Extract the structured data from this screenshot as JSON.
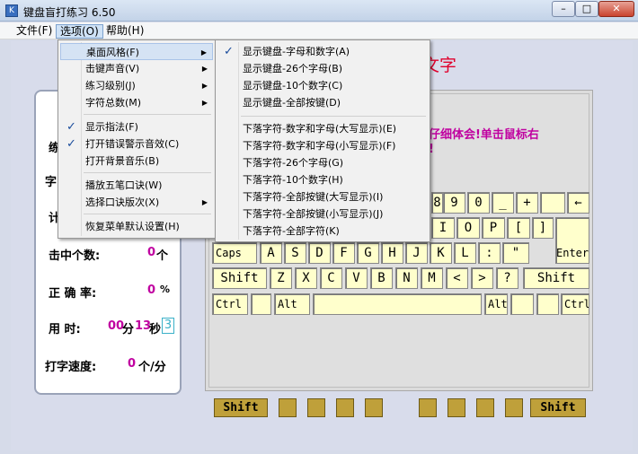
{
  "window": {
    "title": "键盘盲打练习 6.50",
    "icon": "K",
    "min": "–",
    "max": "□",
    "close": "✕"
  },
  "menubar": {
    "file": "文件(F)",
    "options": "选项(O)",
    "help": "帮助(H)"
  },
  "title_text": "文字",
  "message": [
    "仔细体会!单击鼠标右",
    "!"
  ],
  "stats": {
    "l1": "练",
    "l2": "字",
    "l3": "计",
    "hits_label": "击中个数:",
    "hits_value": "0",
    "hits_unit": "个",
    "accuracy_label": "正 确 率:",
    "accuracy_value": "0",
    "accuracy_unit": "%",
    "time_label": "用 时:",
    "time_min": "00",
    "min_unit": "分",
    "time_sec": "13",
    "sec_unit": "秒",
    "time_box": "3",
    "speed_label": "打字速度:",
    "speed_value": "0",
    "speed_unit": "个/分"
  },
  "menu1": {
    "items": [
      "桌面风格(F)",
      "击键声音(V)",
      "练习级别(J)",
      "字符总数(M)",
      "显示指法(F)",
      "打开错误警示音效(C)",
      "打开背景音乐(B)",
      "播放五笔口诀(W)",
      "选择口诀版次(X)",
      "恢复菜单默认设置(H)"
    ],
    "check": "✓",
    "arrow": "▶"
  },
  "menu2": {
    "items": [
      "显示键盘-字母和数字(A)",
      "显示键盘-26个字母(B)",
      "显示键盘-10个数字(C)",
      "显示键盘-全部按键(D)",
      "下落字符-数字和字母(大写显示)(E)",
      "下落字符-数字和字母(小写显示)(F)",
      "下落字符-26个字母(G)",
      "下落字符-10个数字(H)",
      "下落字符-全部按键(大写显示)(I)",
      "下落字符-全部按键(小写显示)(J)",
      "下落字符-全部字符(K)"
    ]
  },
  "keys": {
    "n8": "8",
    "n9": "9",
    "n0": "0",
    "minus": "_",
    "eq": "+",
    "bs": "←",
    "i": "I",
    "o": "O",
    "p": "P",
    "lb": "[",
    "rb": "]",
    "enter": "Enter",
    "caps": "Caps",
    "a": "A",
    "s": "S",
    "d": "D",
    "f": "F",
    "g": "G",
    "h": "H",
    "j": "J",
    "k": "K",
    "l": "L",
    "semi": ":",
    "quote": "\"",
    "lshift": "Shift",
    "z": "Z",
    "x": "X",
    "c": "C",
    "v": "V",
    "b": "B",
    "n": "N",
    "m": "M",
    "comma": "<",
    "dot": ">",
    "slash": "?",
    "rshift": "Shift",
    "ctrl": "Ctrl",
    "alt": "Alt",
    "ralt": "Alt",
    "rctrl": "Ctrl"
  },
  "bottom": {
    "lshift": "Shift",
    "rshift": "Shift"
  }
}
